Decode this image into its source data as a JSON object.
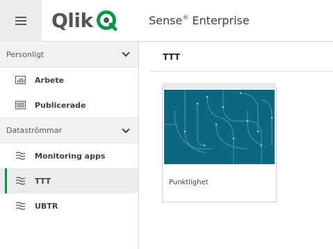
{
  "header": {
    "logo_text": "Qlik",
    "product_name": "Sense",
    "product_reg": "®",
    "product_suffix": " Enterprise"
  },
  "sidebar": {
    "personal_section": {
      "label": "Personligt",
      "items": [
        {
          "label": "Arbete",
          "icon": "bar-chart-icon"
        },
        {
          "label": "Publicerade",
          "icon": "published-icon"
        }
      ]
    },
    "streams_section": {
      "label": "Dataströmmar",
      "items": [
        {
          "label": "Monitoring apps",
          "icon": "stream-icon",
          "active": false
        },
        {
          "label": "TTT",
          "icon": "stream-icon",
          "active": true
        },
        {
          "label": "UBTR",
          "icon": "stream-icon",
          "active": false
        }
      ]
    }
  },
  "main": {
    "title": "TTT",
    "apps": [
      {
        "name": "Punktlighet"
      }
    ]
  },
  "colors": {
    "accent": "#009845",
    "logo_q": "#009845",
    "thumbnail": "#0d6780"
  }
}
